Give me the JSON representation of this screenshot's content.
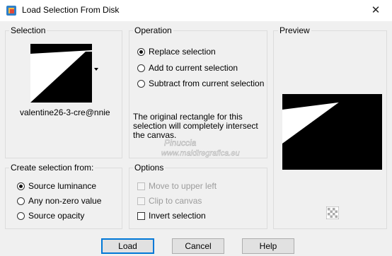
{
  "window": {
    "title": "Load Selection From Disk"
  },
  "selection": {
    "label": "Selection",
    "thumbnail_name": "valentine26-3-cre@nnie"
  },
  "operation": {
    "label": "Operation",
    "options": [
      "Replace selection",
      "Add to current selection",
      "Subtract from current selection"
    ],
    "selected_index": 0,
    "info_text": "The original rectangle for this selection will completely intersect the canvas."
  },
  "preview": {
    "label": "Preview"
  },
  "create_from": {
    "label": "Create selection from:",
    "options": [
      "Source luminance",
      "Any non-zero value",
      "Source opacity"
    ],
    "selected_index": 0
  },
  "options": {
    "label": "Options",
    "move_upper_left": "Move to upper left",
    "clip_canvas": "Clip to canvas",
    "invert_selection": "Invert selection",
    "move_upper_left_checked": false,
    "clip_canvas_checked": false,
    "invert_selection_checked": false
  },
  "buttons": {
    "load": "Load",
    "cancel": "Cancel",
    "help": "Help"
  },
  "watermark": {
    "line1": "Pinuccia",
    "line2": "www.maidiregrafica.eu"
  }
}
